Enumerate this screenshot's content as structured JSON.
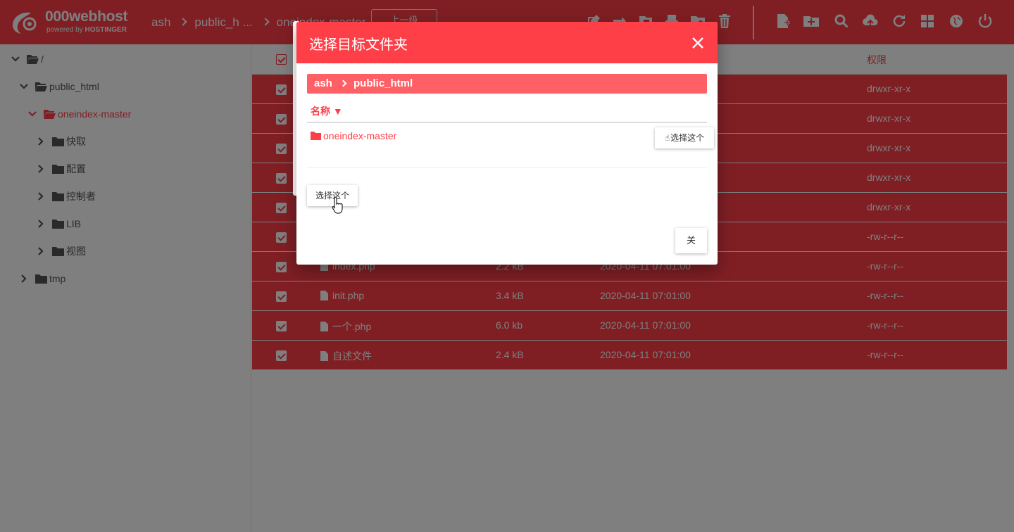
{
  "app": {
    "logo_name": "000webhost",
    "logo_sub_prefix": "powered by",
    "logo_sub_brand": "HOSTINGER"
  },
  "breadcrumb": [
    "ash",
    "public_h ...",
    "oneindex-master"
  ],
  "toolbar": {
    "top_button_label": "上一级",
    "icons": [
      "edit-icon",
      "move-icon",
      "copy-icon",
      "archive-icon",
      "permissions-icon",
      "trash-icon",
      "new-file-icon",
      "new-folder-icon",
      "search-icon",
      "upload-icon",
      "refresh-icon",
      "grid-view-icon",
      "globe-icon",
      "power-icon"
    ]
  },
  "sidebar": {
    "items": [
      {
        "label": "/",
        "expanded": true
      },
      {
        "label": "public_html",
        "expanded": true
      },
      {
        "label": "oneindex-master",
        "expanded": true,
        "active": true
      },
      {
        "label": "快取",
        "expanded": false
      },
      {
        "label": "配置",
        "expanded": false
      },
      {
        "label": "控制者",
        "expanded": false
      },
      {
        "label": "LIB",
        "expanded": false
      },
      {
        "label": "视图",
        "expanded": false
      },
      {
        "label": "tmp",
        "expanded": false
      }
    ]
  },
  "table": {
    "perm_header": "权限",
    "rows": [
      {
        "name": "",
        "size": "",
        "date": "",
        "perm": "drwxr-xr-x"
      },
      {
        "name": "",
        "size": "",
        "date": "",
        "perm": "drwxr-xr-x"
      },
      {
        "name": "",
        "size": "",
        "date": "",
        "perm": "drwxr-xr-x"
      },
      {
        "name": "",
        "size": "",
        "date": "",
        "perm": "drwxr-xr-x"
      },
      {
        "name": "",
        "size": "",
        "date": "",
        "perm": "drwxr-xr-x"
      },
      {
        "name": "",
        "size": "",
        "date": "",
        "perm": "-rw-r--r--"
      },
      {
        "name": "index.php",
        "size": "2.2 kB",
        "date": "2020-04-11 07:01:00",
        "perm": "-rw-r--r--"
      },
      {
        "name": "init.php",
        "size": "3.4 kB",
        "date": "2020-04-11 07:01:00",
        "perm": "-rw-r--r--"
      },
      {
        "name": "一个.php",
        "size": "6.0 kb",
        "date": "2020-04-11 07:01:00",
        "perm": "-rw-r--r--"
      },
      {
        "name": "自述文件",
        "size": "2.4 kB",
        "date": "2020-04-11 07:01:00",
        "perm": "-rw-r--r--"
      }
    ]
  },
  "modal": {
    "title": "选择目标文件夹",
    "breadcrumb": [
      "ash",
      "public_html"
    ],
    "name_header": "名称 ▼",
    "folders": [
      {
        "name": "oneindex-master",
        "select_label": "选择这个"
      }
    ],
    "select_current_label": "选择这个",
    "close_label": "关"
  },
  "colors": {
    "accent": "#ff3f48",
    "accent_light": "#ff6066",
    "overlay": "rgba(0,0,0,0.5)"
  }
}
